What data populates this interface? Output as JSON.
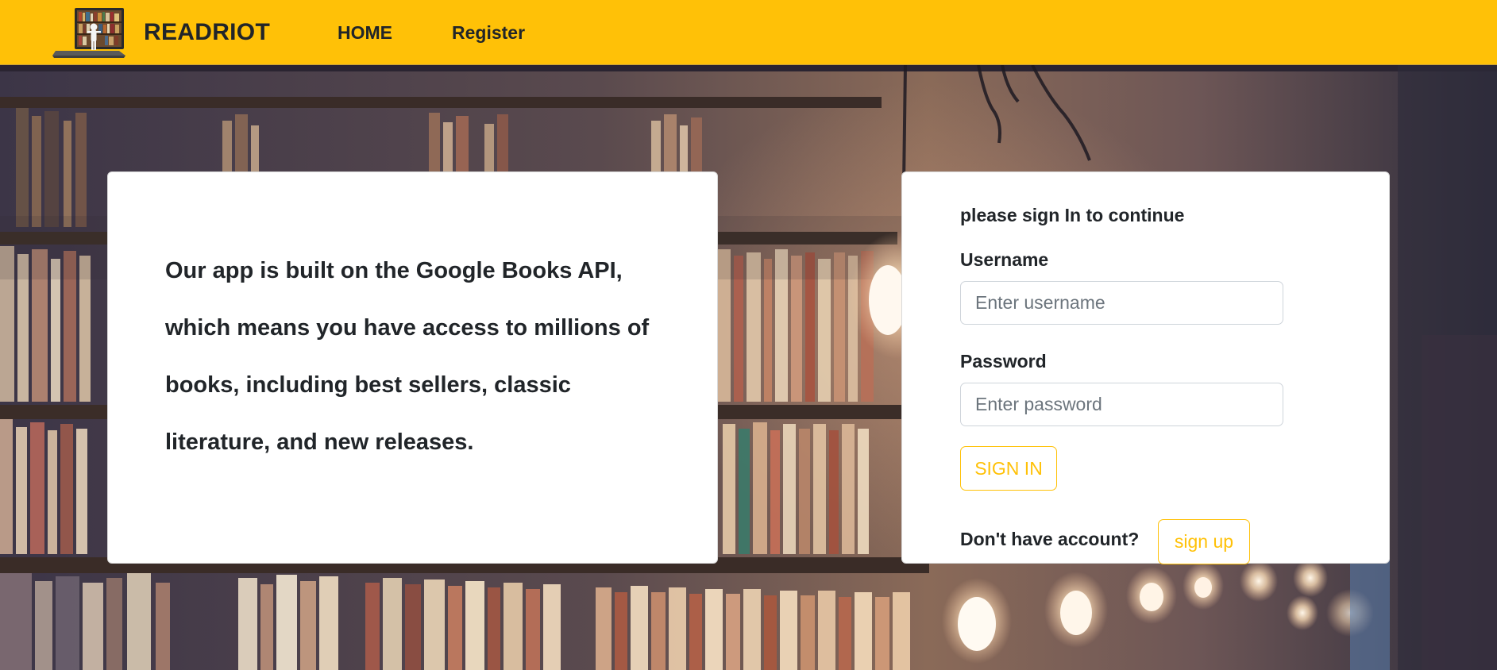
{
  "nav": {
    "brand": "READRIOT",
    "links": [
      {
        "label": "HOME"
      },
      {
        "label": "Register"
      }
    ]
  },
  "info": {
    "text": "Our app is built on the Google Books API, which means you have access to millions of books, including best sellers, classic literature, and new releases."
  },
  "login": {
    "heading": "please sign In to continue",
    "username_label": "Username",
    "username_placeholder": "Enter username",
    "username_value": "",
    "password_label": "Password",
    "password_placeholder": "Enter password",
    "password_value": "",
    "signin_label": "SIGN IN",
    "no_account_text": "Don't have account?",
    "signup_label": "sign up"
  },
  "colors": {
    "accent": "#ffc107",
    "text": "#212529",
    "placeholder": "#6c757d",
    "card": "#ffffff"
  },
  "icons": {
    "logo": "laptop-with-books-logo"
  }
}
